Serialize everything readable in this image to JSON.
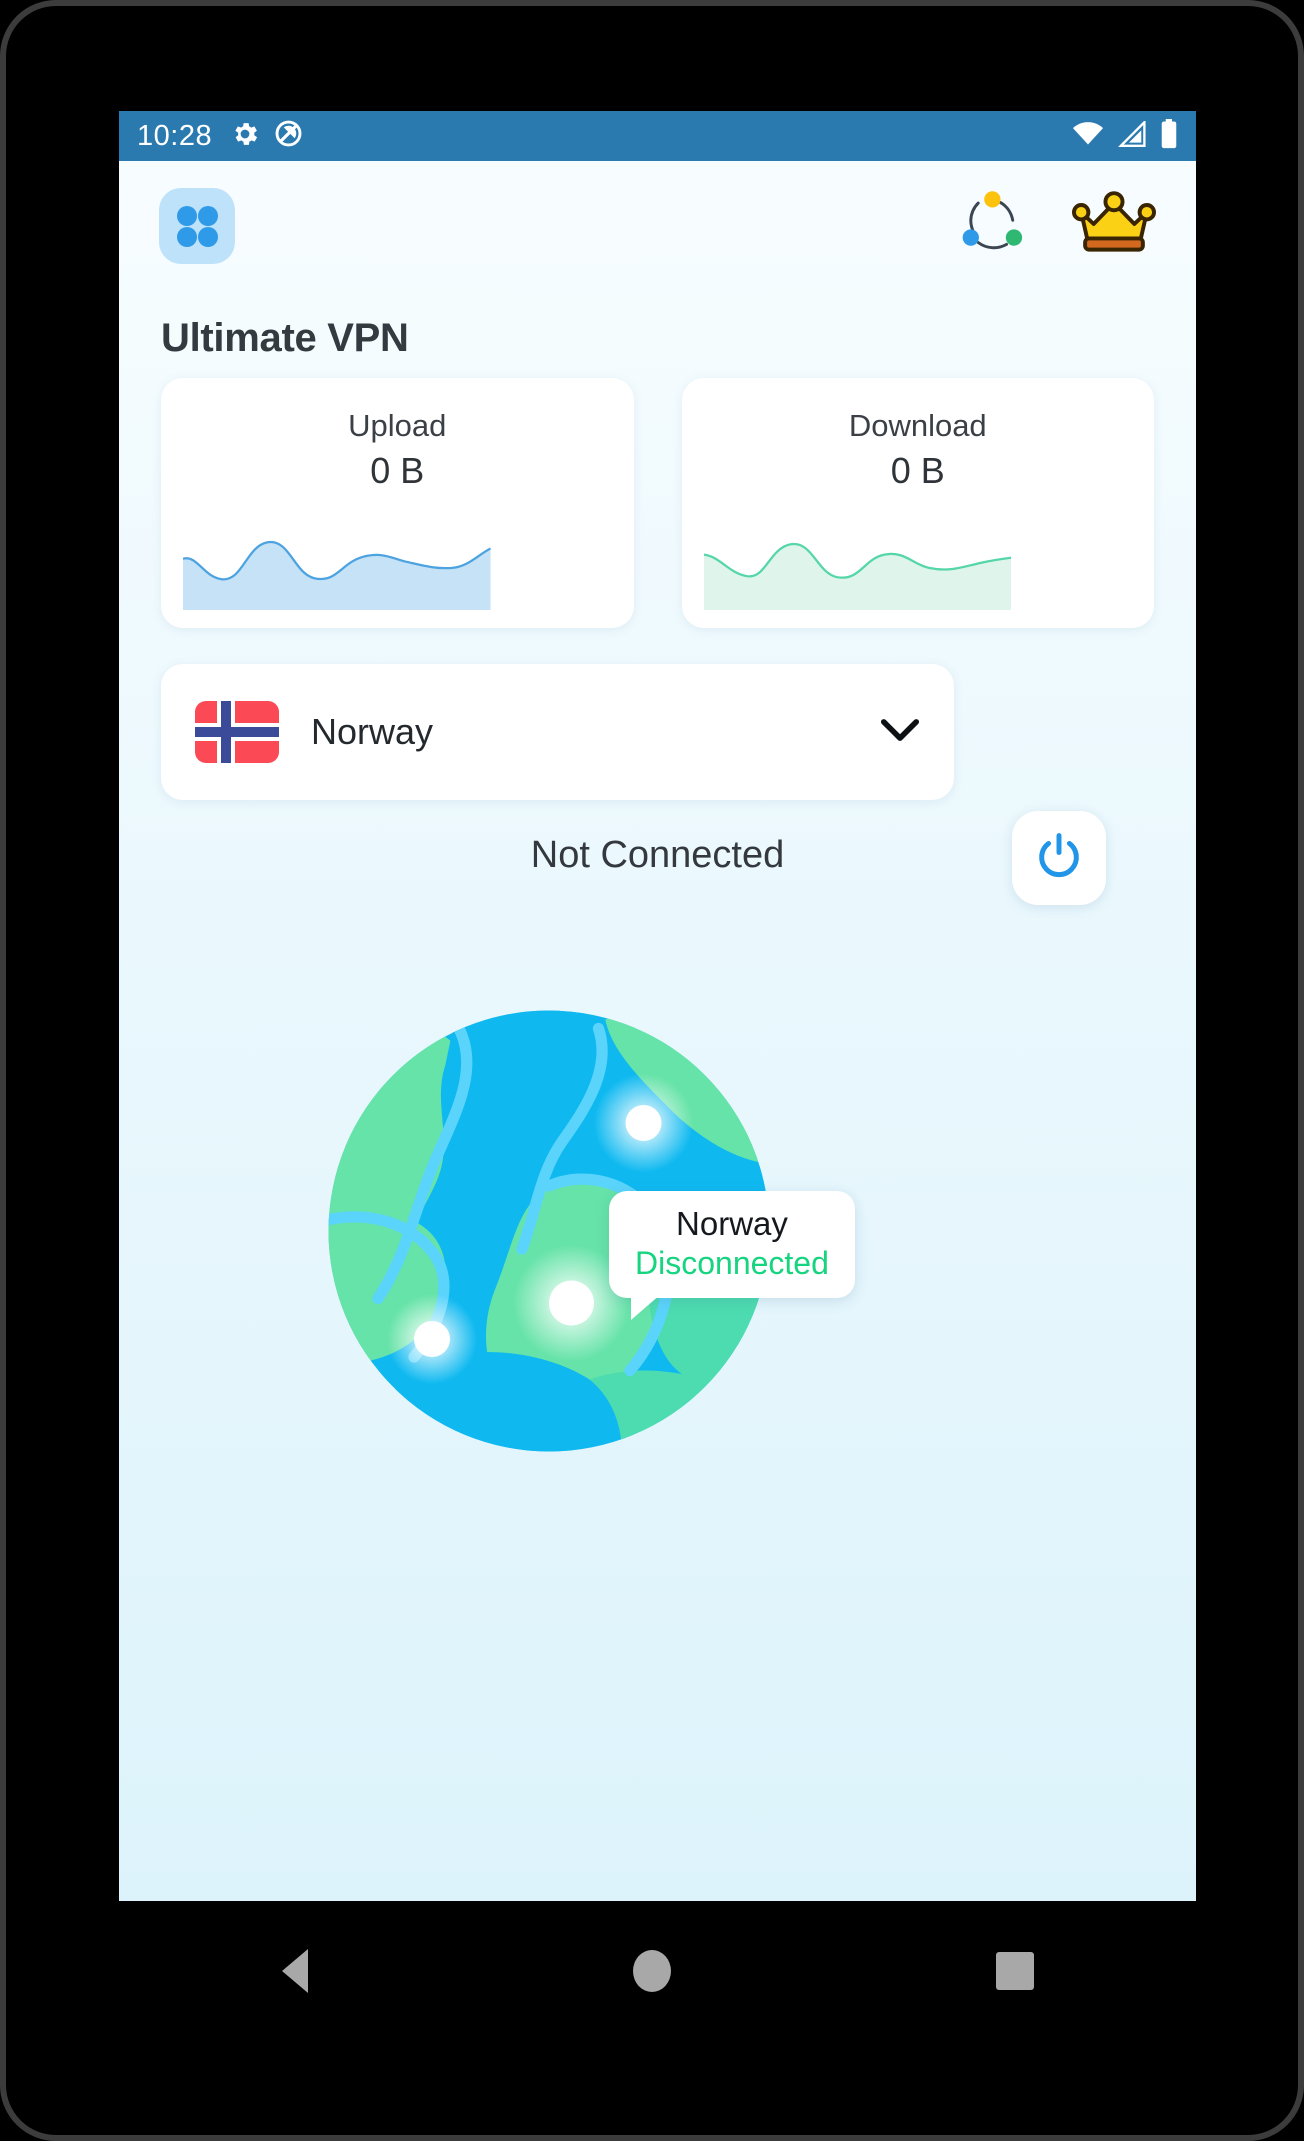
{
  "device": {
    "nav_bar": [
      {
        "name": "back",
        "icon": "triangle-left-icon"
      },
      {
        "name": "home",
        "icon": "circle-icon"
      },
      {
        "name": "recents",
        "icon": "square-icon"
      }
    ]
  },
  "status_bar": {
    "time": "10:28",
    "left_icons": [
      "gear-icon",
      "do-not-disturb-icon"
    ],
    "right_icons": [
      "wifi-icon",
      "cellular-signal-icon",
      "battery-icon"
    ],
    "background_color": "#2a7ab0"
  },
  "header": {
    "launcher_icon": "grid-apps-icon",
    "actions": [
      {
        "name": "connection-status-icon",
        "icon": "circular-nodes-icon"
      },
      {
        "name": "premium-crown-icon",
        "icon": "crown-icon"
      }
    ]
  },
  "app": {
    "title": "Ultimate VPN",
    "accent_color": "#2e9ae8",
    "background_gradient": [
      "#f8fdff",
      "#ddf3fb"
    ]
  },
  "stats": [
    {
      "label": "Upload",
      "value": "0 B",
      "spark_color": "#4da3e0",
      "spark_fill": "#c5e2f7"
    },
    {
      "label": "Download",
      "value": "0 B",
      "spark_color": "#54d6a8",
      "spark_fill": "#dff5ec"
    }
  ],
  "country_selector": {
    "country": "Norway",
    "flag": "norway-flag-icon",
    "chevron": "chevron-down-icon"
  },
  "connection": {
    "status_text": "Not Connected",
    "power_button_icon": "power-icon",
    "power_button_color": "#2196e8"
  },
  "map": {
    "globe_icon": "globe-icon",
    "tooltip": {
      "country": "Norway",
      "state": "Disconnected",
      "state_color": "#16d47f"
    },
    "markers": 3
  },
  "chart_data": [
    {
      "type": "area",
      "title": "Upload",
      "values": [
        38,
        22,
        18,
        22,
        48,
        55,
        42,
        26,
        20,
        24,
        36,
        44,
        46,
        40,
        32,
        30,
        32,
        36,
        52
      ],
      "ylim": [
        0,
        80
      ],
      "color": "#4da3e0"
    },
    {
      "type": "area",
      "title": "Download",
      "values": [
        44,
        34,
        26,
        24,
        30,
        48,
        56,
        46,
        30,
        24,
        28,
        42,
        46,
        38,
        30,
        30,
        34,
        38,
        44
      ],
      "ylim": [
        0,
        80
      ],
      "color": "#54d6a8"
    }
  ]
}
